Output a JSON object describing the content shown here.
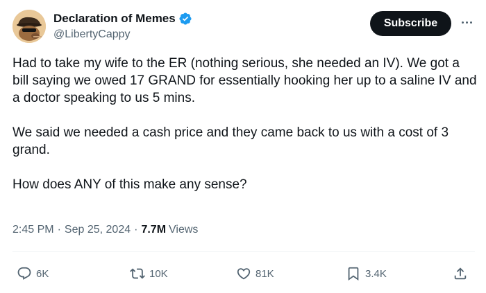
{
  "author": {
    "name": "Declaration of Memes",
    "handle": "@LibertyCappy",
    "verified": true,
    "verified_color": "#1d9bf0"
  },
  "subscribe_label": "Subscribe",
  "tweet": {
    "paragraphs": [
      "Had to take my wife to the ER (nothing serious, she needed an IV). We got a bill saying we owed 17 GRAND for essentially hooking her up to a saline IV and a doctor speaking to us 5 mins.",
      "We said we needed a cash price and they came back to us with a cost of 3 grand.",
      "How does ANY of this make any sense?"
    ],
    "time": "2:45 PM",
    "date": "Sep 25, 2024",
    "views_count": "7.7M",
    "views_label": "Views"
  },
  "actions": {
    "replies": "6K",
    "reposts": "10K",
    "likes": "81K",
    "bookmarks": "3.4K"
  },
  "icons": {
    "reply": "reply-icon",
    "repost": "repost-icon",
    "like": "heart-icon",
    "bookmark": "bookmark-icon",
    "share": "share-icon",
    "more": "more-icon",
    "verified": "verified-badge-icon"
  }
}
